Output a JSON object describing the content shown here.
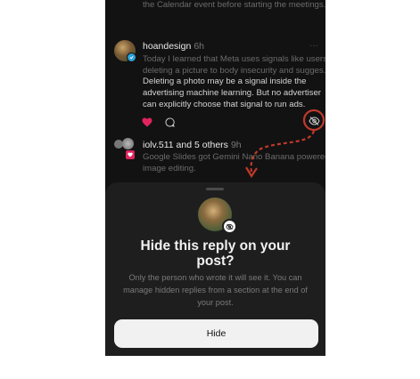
{
  "feed": {
    "top_line": "the Calendar event before starting the meetings.",
    "reply": {
      "username": "hoandesign",
      "time": "6h",
      "lines": [
        "Today I learned that Meta uses signals like users",
        "deleting a picture to body insecurity and sugges...",
        "Deleting a photo may be a signal inside the",
        "advertising machine learning. But no advertiser",
        "can explicitly choose that signal to run ads."
      ]
    },
    "next_post": {
      "username": "iolv.511 and 5 others",
      "time": "9h",
      "lines": [
        "Google Slides got Gemini Nano Banana powered",
        "image editing."
      ]
    }
  },
  "sheet": {
    "title_line1": "Hide this reply on your",
    "title_line2": "post?",
    "desc_line1": "Only the person who wrote it will see it. You can",
    "desc_line2": "manage hidden replies from a section at the end of",
    "desc_line3": "your post.",
    "hide_label": "Hide"
  },
  "colors": {
    "annotation": "#c0392b",
    "like": "#e0245e",
    "sheet_bg": "#1e1e1e"
  }
}
